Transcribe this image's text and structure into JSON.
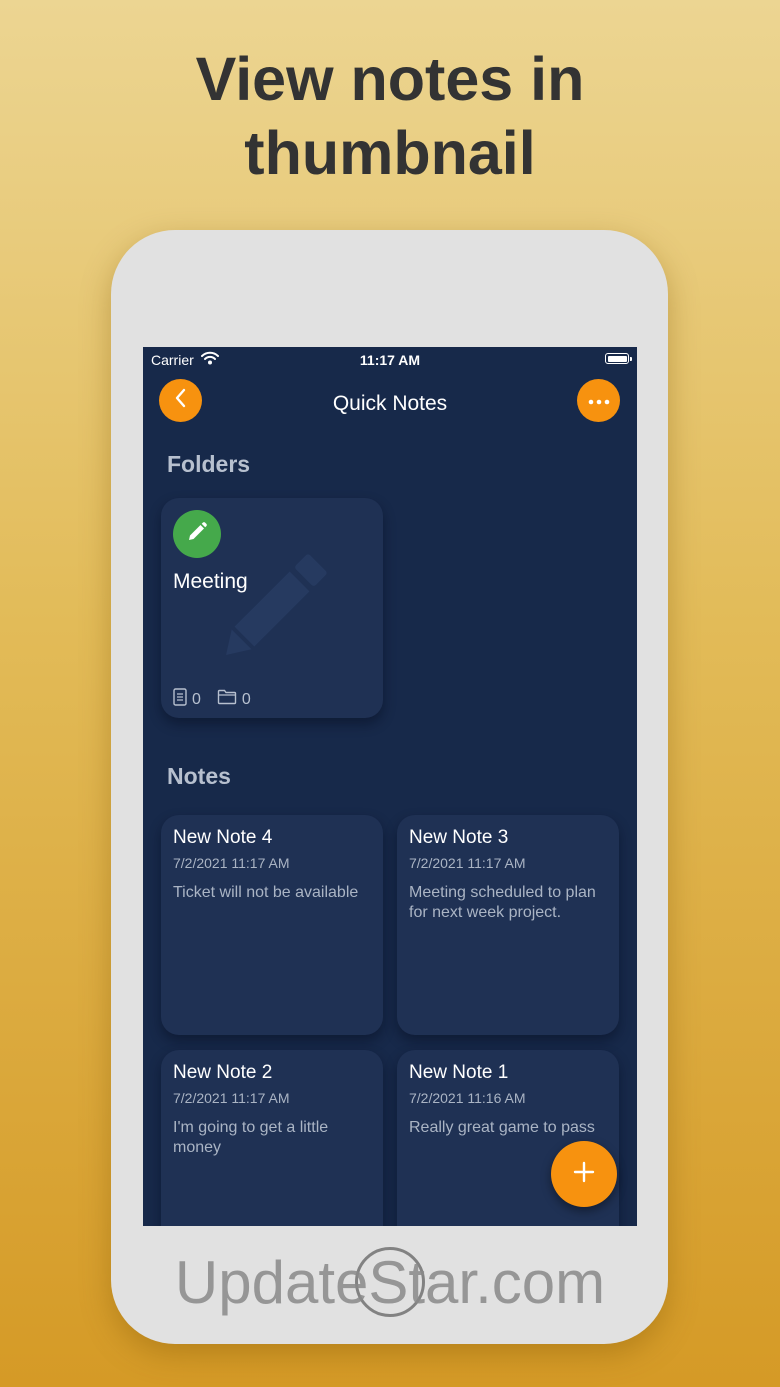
{
  "headline": {
    "line1": "View notes in",
    "line2": "thumbnail"
  },
  "status_bar": {
    "carrier": "Carrier",
    "time": "11:17 AM"
  },
  "nav": {
    "title": "Quick Notes",
    "back_icon": "chevron-left-icon",
    "more_icon": "ellipsis-icon"
  },
  "folders": {
    "title": "Folders",
    "items": [
      {
        "name": "Meeting",
        "icon": "pencil-icon",
        "notes_count": "0",
        "folders_count": "0"
      }
    ]
  },
  "notes": {
    "title": "Notes",
    "items": [
      {
        "title": "New Note 4",
        "date": "7/2/2021 11:17 AM",
        "body": "Ticket will not be available"
      },
      {
        "title": "New Note 3",
        "date": "7/2/2021 11:17 AM",
        "body": "Meeting scheduled to plan for next week project."
      },
      {
        "title": "New Note 2",
        "date": "7/2/2021 11:17 AM",
        "body": "I'm going to get a little money"
      },
      {
        "title": "New Note 1",
        "date": "7/2/2021 11:16 AM",
        "body": "Really great game to pass"
      }
    ]
  },
  "fab": {
    "icon": "plus-icon"
  },
  "watermark": {
    "text": "UpdateStar.com"
  },
  "colors": {
    "accent": "#f7920f",
    "screen_bg": "#17294a",
    "card_bg": "#1f3154",
    "folder_badge": "#45a94b"
  }
}
